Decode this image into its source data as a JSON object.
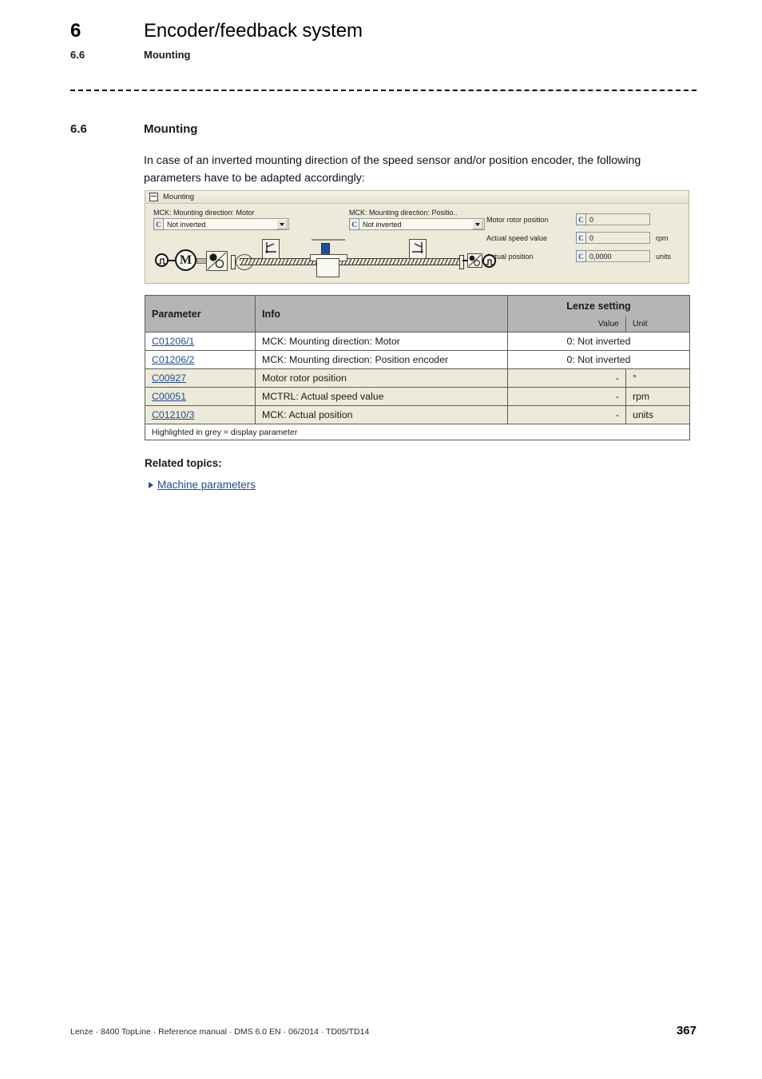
{
  "header": {
    "chapter_number": "6",
    "chapter_title": "Encoder/feedback system",
    "section_number": "6.6",
    "section_title": "Mounting"
  },
  "section": {
    "number": "6.6",
    "title": "Mounting",
    "intro": "In case of an inverted mounting direction of the speed sensor and/or position encoder, the following parameters have to be adapted accordingly:"
  },
  "panel": {
    "title": "Mounting",
    "collapse_icon": "collapse-box-icon",
    "dropdowns": [
      {
        "label": "MCK: Mounting direction: Motor",
        "button_icon": "C",
        "value": "Not inverted",
        "arrow_icon": "chevron-down-icon"
      },
      {
        "label": "MCK: Mounting direction: Positio..",
        "button_icon": "C",
        "value": "Not inverted",
        "arrow_icon": "chevron-down-icon"
      }
    ],
    "readouts": [
      {
        "label": "Motor rotor position",
        "button_icon": "C",
        "value": "0",
        "unit": ""
      },
      {
        "label": "Actual speed value",
        "button_icon": "C",
        "value": "0",
        "unit": "rpm"
      },
      {
        "label": "Actual position",
        "button_icon": "C",
        "value": "0,0000",
        "unit": "units"
      }
    ],
    "schematic": {
      "elements": [
        "encoder-pulse-icon",
        "motor-icon",
        "gearbox-icon",
        "coupling-icon",
        "limit-switch-left-icon",
        "carriage-icon",
        "limit-switch-right-icon",
        "gearbox-right-icon",
        "encoder-right-icon"
      ],
      "motor_label": "M"
    },
    "colors": {
      "panel_background": "#edeada",
      "accent_blue": "#1d4f9c",
      "carriage_indicator": "#1f4e9c"
    }
  },
  "table": {
    "headers": {
      "parameter": "Parameter",
      "info": "Info",
      "lenze_setting": "Lenze setting",
      "value": "Value",
      "unit": "Unit"
    },
    "rows": [
      {
        "parameter": "C01206/1",
        "info": "MCK: Mounting direction: Motor",
        "value": "0: Not inverted",
        "unit": "",
        "merged": true,
        "highlighted": false
      },
      {
        "parameter": "C01206/2",
        "info": "MCK: Mounting direction: Position encoder",
        "value": "0: Not inverted",
        "unit": "",
        "merged": true,
        "highlighted": false
      },
      {
        "parameter": "C00927",
        "info": "Motor rotor position",
        "value": "-",
        "unit": "°",
        "merged": false,
        "highlighted": true
      },
      {
        "parameter": "C00051",
        "info": "MCTRL: Actual speed value",
        "value": "-",
        "unit": "rpm",
        "merged": false,
        "highlighted": true
      },
      {
        "parameter": "C01210/3",
        "info": "MCK: Actual position",
        "value": "-",
        "unit": "units",
        "merged": false,
        "highlighted": true
      }
    ],
    "note": "Highlighted in grey = display parameter"
  },
  "related": {
    "heading": "Related topics:",
    "links": [
      {
        "label": "Machine parameters",
        "bullet_icon": "triangle-right-icon"
      }
    ]
  },
  "footer": {
    "text": "Lenze · 8400 TopLine · Reference manual · DMS 6.0 EN · 06/2014 · TD05/TD14",
    "page": "367"
  }
}
